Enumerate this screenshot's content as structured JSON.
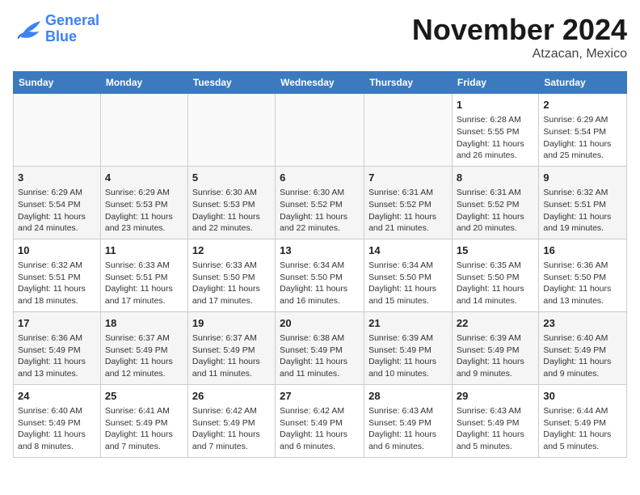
{
  "logo": {
    "text_general": "General",
    "text_blue": "Blue"
  },
  "title": "November 2024",
  "location": "Atzacan, Mexico",
  "days_of_week": [
    "Sunday",
    "Monday",
    "Tuesday",
    "Wednesday",
    "Thursday",
    "Friday",
    "Saturday"
  ],
  "weeks": [
    [
      {
        "day": "",
        "content": ""
      },
      {
        "day": "",
        "content": ""
      },
      {
        "day": "",
        "content": ""
      },
      {
        "day": "",
        "content": ""
      },
      {
        "day": "",
        "content": ""
      },
      {
        "day": "1",
        "content": "Sunrise: 6:28 AM\nSunset: 5:55 PM\nDaylight: 11 hours and 26 minutes."
      },
      {
        "day": "2",
        "content": "Sunrise: 6:29 AM\nSunset: 5:54 PM\nDaylight: 11 hours and 25 minutes."
      }
    ],
    [
      {
        "day": "3",
        "content": "Sunrise: 6:29 AM\nSunset: 5:54 PM\nDaylight: 11 hours and 24 minutes."
      },
      {
        "day": "4",
        "content": "Sunrise: 6:29 AM\nSunset: 5:53 PM\nDaylight: 11 hours and 23 minutes."
      },
      {
        "day": "5",
        "content": "Sunrise: 6:30 AM\nSunset: 5:53 PM\nDaylight: 11 hours and 22 minutes."
      },
      {
        "day": "6",
        "content": "Sunrise: 6:30 AM\nSunset: 5:52 PM\nDaylight: 11 hours and 22 minutes."
      },
      {
        "day": "7",
        "content": "Sunrise: 6:31 AM\nSunset: 5:52 PM\nDaylight: 11 hours and 21 minutes."
      },
      {
        "day": "8",
        "content": "Sunrise: 6:31 AM\nSunset: 5:52 PM\nDaylight: 11 hours and 20 minutes."
      },
      {
        "day": "9",
        "content": "Sunrise: 6:32 AM\nSunset: 5:51 PM\nDaylight: 11 hours and 19 minutes."
      }
    ],
    [
      {
        "day": "10",
        "content": "Sunrise: 6:32 AM\nSunset: 5:51 PM\nDaylight: 11 hours and 18 minutes."
      },
      {
        "day": "11",
        "content": "Sunrise: 6:33 AM\nSunset: 5:51 PM\nDaylight: 11 hours and 17 minutes."
      },
      {
        "day": "12",
        "content": "Sunrise: 6:33 AM\nSunset: 5:50 PM\nDaylight: 11 hours and 17 minutes."
      },
      {
        "day": "13",
        "content": "Sunrise: 6:34 AM\nSunset: 5:50 PM\nDaylight: 11 hours and 16 minutes."
      },
      {
        "day": "14",
        "content": "Sunrise: 6:34 AM\nSunset: 5:50 PM\nDaylight: 11 hours and 15 minutes."
      },
      {
        "day": "15",
        "content": "Sunrise: 6:35 AM\nSunset: 5:50 PM\nDaylight: 11 hours and 14 minutes."
      },
      {
        "day": "16",
        "content": "Sunrise: 6:36 AM\nSunset: 5:50 PM\nDaylight: 11 hours and 13 minutes."
      }
    ],
    [
      {
        "day": "17",
        "content": "Sunrise: 6:36 AM\nSunset: 5:49 PM\nDaylight: 11 hours and 13 minutes."
      },
      {
        "day": "18",
        "content": "Sunrise: 6:37 AM\nSunset: 5:49 PM\nDaylight: 11 hours and 12 minutes."
      },
      {
        "day": "19",
        "content": "Sunrise: 6:37 AM\nSunset: 5:49 PM\nDaylight: 11 hours and 11 minutes."
      },
      {
        "day": "20",
        "content": "Sunrise: 6:38 AM\nSunset: 5:49 PM\nDaylight: 11 hours and 11 minutes."
      },
      {
        "day": "21",
        "content": "Sunrise: 6:39 AM\nSunset: 5:49 PM\nDaylight: 11 hours and 10 minutes."
      },
      {
        "day": "22",
        "content": "Sunrise: 6:39 AM\nSunset: 5:49 PM\nDaylight: 11 hours and 9 minutes."
      },
      {
        "day": "23",
        "content": "Sunrise: 6:40 AM\nSunset: 5:49 PM\nDaylight: 11 hours and 9 minutes."
      }
    ],
    [
      {
        "day": "24",
        "content": "Sunrise: 6:40 AM\nSunset: 5:49 PM\nDaylight: 11 hours and 8 minutes."
      },
      {
        "day": "25",
        "content": "Sunrise: 6:41 AM\nSunset: 5:49 PM\nDaylight: 11 hours and 7 minutes."
      },
      {
        "day": "26",
        "content": "Sunrise: 6:42 AM\nSunset: 5:49 PM\nDaylight: 11 hours and 7 minutes."
      },
      {
        "day": "27",
        "content": "Sunrise: 6:42 AM\nSunset: 5:49 PM\nDaylight: 11 hours and 6 minutes."
      },
      {
        "day": "28",
        "content": "Sunrise: 6:43 AM\nSunset: 5:49 PM\nDaylight: 11 hours and 6 minutes."
      },
      {
        "day": "29",
        "content": "Sunrise: 6:43 AM\nSunset: 5:49 PM\nDaylight: 11 hours and 5 minutes."
      },
      {
        "day": "30",
        "content": "Sunrise: 6:44 AM\nSunset: 5:49 PM\nDaylight: 11 hours and 5 minutes."
      }
    ]
  ]
}
